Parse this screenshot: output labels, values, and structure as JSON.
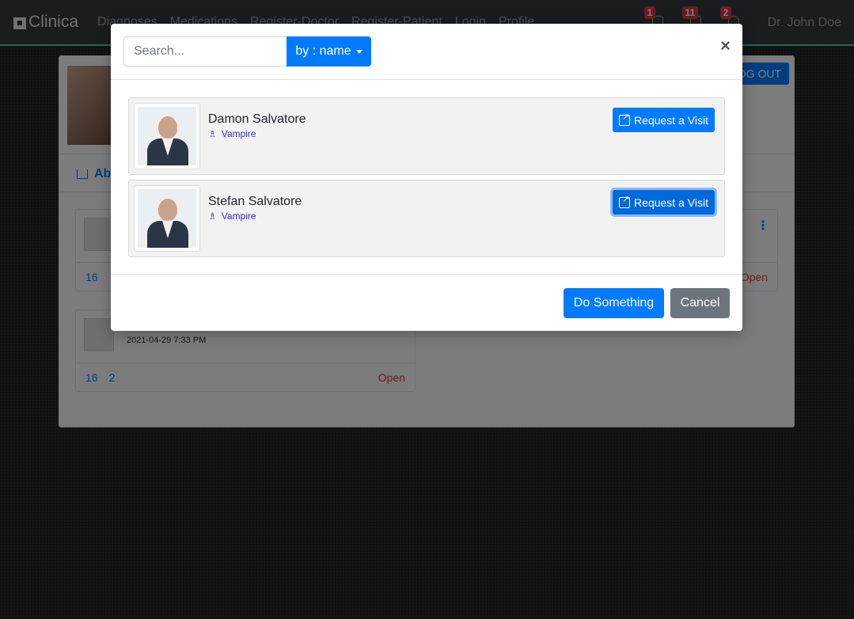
{
  "navbar": {
    "brand": "Clinica",
    "links": [
      "Diagnoses",
      "Medications",
      "Register-Doctor",
      "Register-Patient",
      "Login",
      "Profile"
    ],
    "badges": {
      "notifications": "1",
      "messages": "11",
      "alerts": "2"
    },
    "user": "Dr. John Doe"
  },
  "background": {
    "logout_label": "LOG OUT",
    "tab_label": "Ab",
    "post_date": "2021-04-29 7:33 PM",
    "post_comments": "16",
    "post_images": "2",
    "post_status": "Open"
  },
  "modal": {
    "search_placeholder": "Search...",
    "filter_label": "by : name",
    "close_symbol": "×",
    "doctors": [
      {
        "name": "Damon Salvatore",
        "specialty": "Vampire",
        "action": "Request a Visit"
      },
      {
        "name": "Stefan Salvatore",
        "specialty": "Vampire",
        "action": "Request a Visit"
      }
    ],
    "primary_button": "Do Something",
    "cancel_button": "Cancel"
  },
  "colors": {
    "primary": "#007bff",
    "secondary": "#6c757d",
    "danger": "#dc3545",
    "specialty": "#3333cc"
  }
}
